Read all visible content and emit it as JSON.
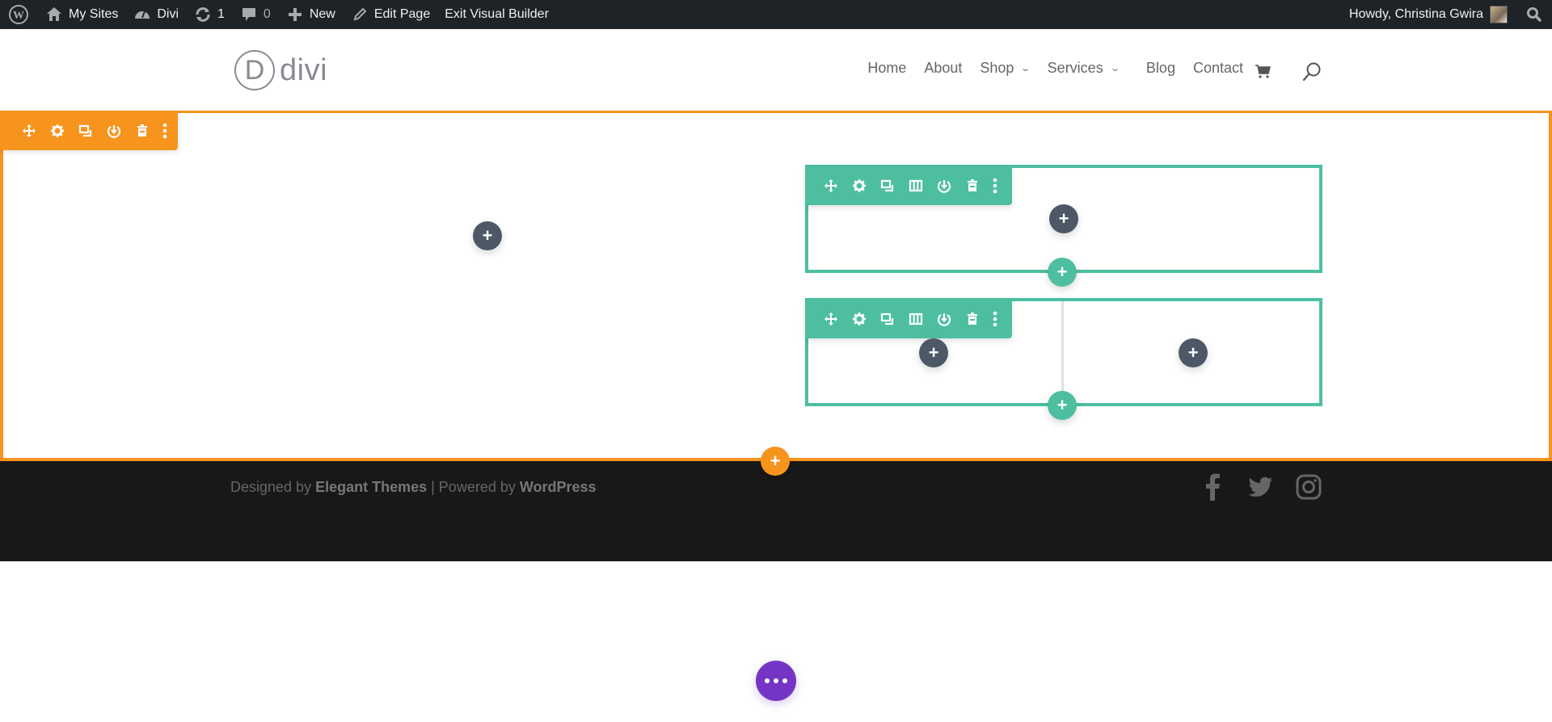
{
  "admin_bar": {
    "wordpress_icon": "wordpress-logo-icon",
    "items": [
      {
        "label": "My Sites",
        "icon": "my-sites-icon"
      },
      {
        "label": "Divi",
        "icon": "dashboard-icon"
      },
      {
        "label": "1",
        "icon": "updates-icon"
      },
      {
        "label": "0",
        "icon": "comments-icon"
      },
      {
        "label": "New",
        "icon": "plus-icon"
      },
      {
        "label": "Edit Page",
        "icon": "pencil-icon"
      },
      {
        "label": "Exit Visual Builder"
      }
    ],
    "greeting": "Howdy, Christina Gwira",
    "search_icon": "search-icon"
  },
  "header": {
    "logo_letter": "D",
    "logo_text": "divi",
    "nav": [
      {
        "label": "Home",
        "has_dropdown": false
      },
      {
        "label": "About",
        "has_dropdown": false
      },
      {
        "label": "Shop",
        "has_dropdown": true
      },
      {
        "label": "Services",
        "has_dropdown": true
      },
      {
        "label": "Blog",
        "has_dropdown": false
      },
      {
        "label": "Contact",
        "has_dropdown": false
      }
    ],
    "cart_icon": "cart-icon",
    "search_icon": "search-icon"
  },
  "builder": {
    "section_color": "#f7941d",
    "row_color": "#4dbfa0",
    "module_add_color": "#4c5866",
    "section_toolbar": [
      "move",
      "settings",
      "duplicate",
      "save-to-library",
      "delete",
      "more"
    ],
    "row_toolbar": [
      "move",
      "settings",
      "duplicate",
      "columns",
      "save-to-library",
      "delete",
      "more"
    ],
    "add_symbol": "+"
  },
  "footer": {
    "designed_by_prefix": "Designed by ",
    "designed_by_link": "Elegant Themes",
    "separator": " | Powered by ",
    "powered_by_link": "WordPress",
    "social": [
      "facebook",
      "twitter",
      "instagram"
    ]
  },
  "page_settings_color": "#7535c4"
}
